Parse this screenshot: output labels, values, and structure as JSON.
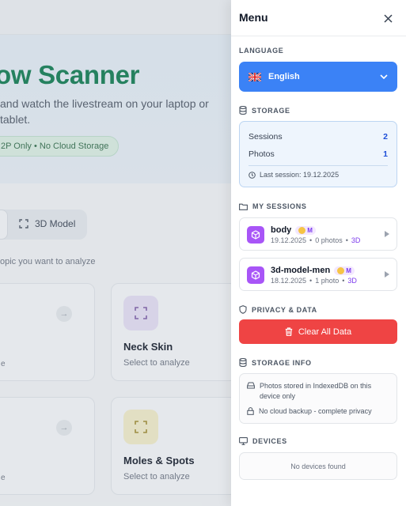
{
  "background": {
    "hero_title": "ow Scanner",
    "hero_subtitle_line1": "and watch the livestream on your laptop or",
    "hero_subtitle_line2": "tablet.",
    "hero_badge": "2P Only • No Cloud Storage",
    "mode_tab_3d": "3D Model",
    "prompt": "opic you want to analyze",
    "cards": [
      {
        "fragment": "e"
      },
      {
        "title": "Neck Skin",
        "subtitle": "Select to analyze",
        "icon": "focus-frame-icon",
        "tile_color": "#e6def5"
      },
      {
        "fragment": "e"
      },
      {
        "title": "Moles & Spots",
        "subtitle": "Select to analyze",
        "icon": "focus-frame-icon",
        "tile_color": "#f3edc8"
      }
    ]
  },
  "menu": {
    "title": "Menu",
    "language": {
      "label": "LANGUAGE",
      "selected": "English",
      "flag": "uk-flag-icon"
    },
    "storage": {
      "label": "STORAGE",
      "sessions_label": "Sessions",
      "sessions_value": "2",
      "photos_label": "Photos",
      "photos_value": "1",
      "last_session": "Last session: 19.12.2025"
    },
    "my_sessions": {
      "label": "MY SESSIONS",
      "items": [
        {
          "name": "body",
          "badge": "M",
          "date": "19.12.2025",
          "photos": "0 photos",
          "tag": "3D"
        },
        {
          "name": "3d-model-men",
          "badge": "M",
          "date": "18.12.2025",
          "photos": "1 photo",
          "tag": "3D"
        }
      ]
    },
    "privacy": {
      "label": "PRIVACY & DATA",
      "clear_button": "Clear All Data"
    },
    "storage_info": {
      "label": "STORAGE INFO",
      "line1": "Photos stored in IndexedDB on this device only",
      "line2": "No cloud backup - complete privacy"
    },
    "devices": {
      "label": "DEVICES",
      "empty": "No devices found"
    }
  },
  "colors": {
    "accent_blue": "#3b82f6",
    "danger_red": "#ef4444",
    "session_purple": "#a855f7",
    "hero_green": "#0d7a4f"
  }
}
